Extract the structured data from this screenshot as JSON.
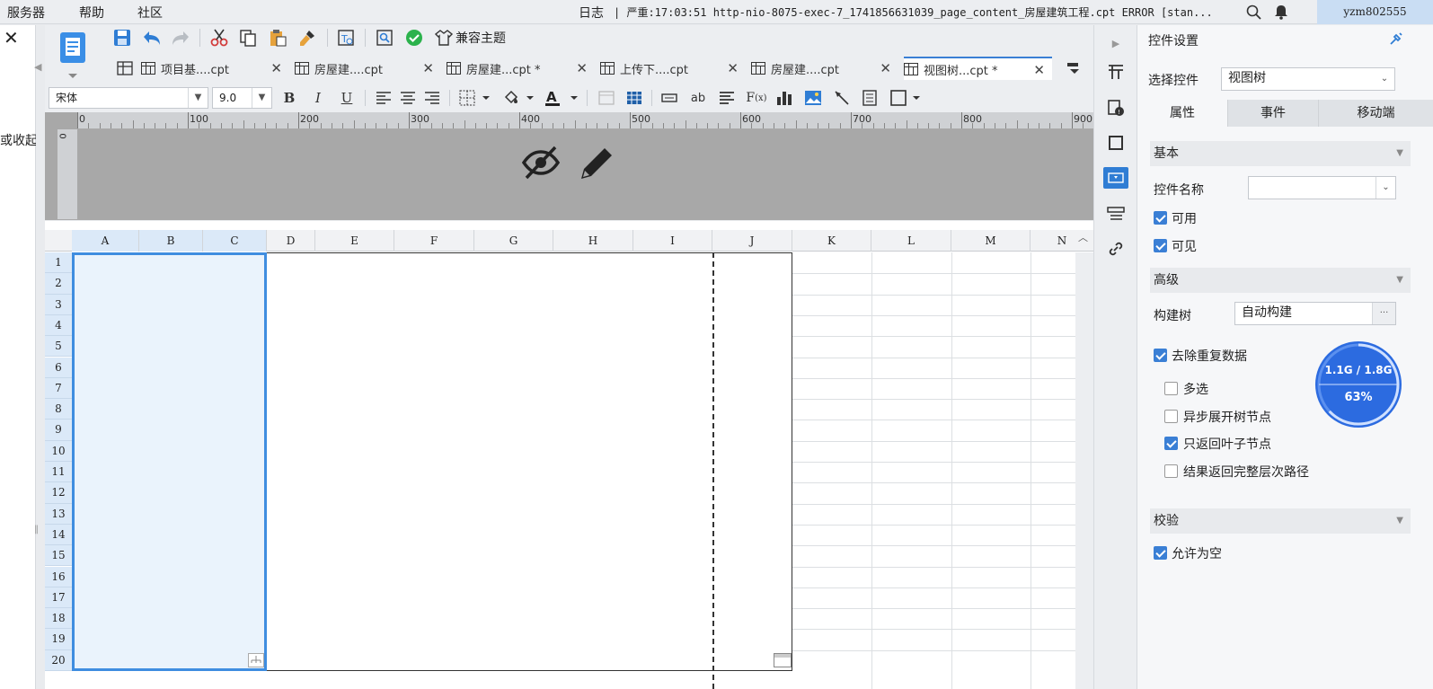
{
  "menu": {
    "server": "服务器",
    "help": "帮助",
    "community": "社区"
  },
  "log": {
    "label": "日志",
    "message": "| 严重:17:03:51 http-nio-8075-exec-7_1741856631039_page_content_房屋建筑工程.cpt ERROR [stan..."
  },
  "user": "yzm802555",
  "left_panel": {
    "fragment": "或收起"
  },
  "toolbar": {
    "theme_label": "兼容主题"
  },
  "tabs": [
    {
      "label": "项目基....cpt"
    },
    {
      "label": "房屋建....cpt"
    },
    {
      "label": "房屋建...cpt *"
    },
    {
      "label": "上传下....cpt"
    },
    {
      "label": "房屋建....cpt"
    },
    {
      "label": "视图树...cpt *"
    }
  ],
  "format": {
    "font": "宋体",
    "size": "9.0"
  },
  "ruler": [
    "0",
    "100",
    "200",
    "300",
    "400",
    "500",
    "600",
    "700",
    "800",
    "900"
  ],
  "ruler_v": "0",
  "columns": [
    "A",
    "B",
    "C",
    "D",
    "E",
    "F",
    "G",
    "H",
    "I",
    "J",
    "K",
    "L",
    "M",
    "N"
  ],
  "rows": [
    "1",
    "2",
    "3",
    "4",
    "5",
    "6",
    "7",
    "8",
    "9",
    "10",
    "11",
    "12",
    "13",
    "14",
    "15",
    "16",
    "17",
    "18",
    "19",
    "20"
  ],
  "panel": {
    "title": "控件设置",
    "select_label": "选择控件",
    "select_value": "视图树",
    "tabs": [
      "属性",
      "事件",
      "移动端"
    ],
    "basic": "基本",
    "name_label": "控件名称",
    "enabled": "可用",
    "visible": "可见",
    "advanced": "高级",
    "build_label": "构建树",
    "build_value": "自动构建",
    "dedupe": "去除重复数据",
    "multi": "多选",
    "async": "异步展开树节点",
    "leaf_only": "只返回叶子节点",
    "full_path": "结果返回完整层次路径",
    "validate": "校验",
    "allow_empty": "允许为空"
  },
  "memory": {
    "usage": "1.1G / 1.8G",
    "percent": "63%",
    "fraction": 0.63
  }
}
